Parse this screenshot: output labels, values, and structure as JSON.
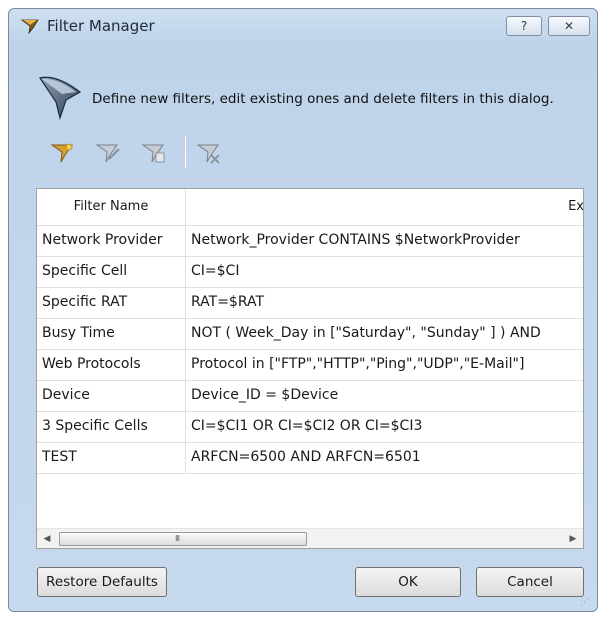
{
  "window": {
    "title": "Filter Manager",
    "help_label": "?",
    "close_label": "✕"
  },
  "header": {
    "description": "Define new filters, edit existing ones and delete filters in this dialog."
  },
  "toolbar": {
    "tools": [
      {
        "name": "new-filter-icon"
      },
      {
        "name": "edit-filter-icon"
      },
      {
        "name": "copy-filter-icon"
      },
      {
        "name": "delete-filter-icon"
      }
    ]
  },
  "table": {
    "columns": [
      "Filter Name",
      "Ex"
    ],
    "rows": [
      {
        "name": "Network Provider",
        "expression": "Network_Provider CONTAINS $NetworkProvider"
      },
      {
        "name": "Specific Cell",
        "expression": "CI=$CI"
      },
      {
        "name": "Specific RAT",
        "expression": "RAT=$RAT"
      },
      {
        "name": "Busy Time",
        "expression": "NOT ( Week_Day in [\"Saturday\", \"Sunday\" ] ) AND"
      },
      {
        "name": "Web Protocols",
        "expression": "Protocol in [\"FTP\",\"HTTP\",\"Ping\",\"UDP\",\"E-Mail\"]"
      },
      {
        "name": "Device",
        "expression": "Device_ID = $Device"
      },
      {
        "name": "3 Specific Cells",
        "expression": "CI=$CI1 OR CI=$CI2 OR CI=$CI3"
      },
      {
        "name": "TEST",
        "expression": "ARFCN=6500 AND ARFCN=6501"
      }
    ]
  },
  "scrollbar": {
    "left_arrow": "◀",
    "right_arrow": "▶",
    "grip": "III"
  },
  "buttons": {
    "restore": "Restore Defaults",
    "ok": "OK",
    "cancel": "Cancel"
  },
  "colors": {
    "title_bar": "#c6d9ee",
    "client": "#f0f0f0",
    "filter_icon": "#c98a1a"
  }
}
